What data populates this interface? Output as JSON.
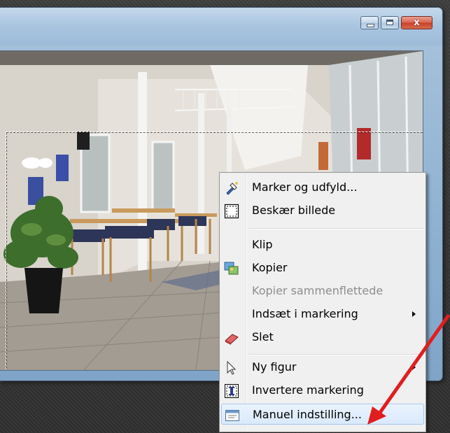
{
  "window": {
    "caption_buttons": [
      {
        "name": "minimize",
        "icon": "minimize-icon"
      },
      {
        "name": "maximize",
        "icon": "maximize-icon"
      },
      {
        "name": "close",
        "icon": "close-icon",
        "glyph": "x"
      }
    ]
  },
  "image": {
    "description_icon": "interior-photo"
  },
  "context_menu": {
    "items": [
      {
        "label": "Marker og udfyld...",
        "icon": "magic-wand-fill-icon",
        "enabled": true,
        "submenu": false
      },
      {
        "label": "Beskær billede",
        "icon": "crop-selection-icon",
        "enabled": true,
        "submenu": false
      },
      {
        "label": "Klip",
        "icon": "",
        "enabled": true,
        "submenu": false
      },
      {
        "label": "Kopier",
        "icon": "copy-images-icon",
        "enabled": true,
        "submenu": false
      },
      {
        "label": "Kopier sammenflettede",
        "icon": "",
        "enabled": false,
        "submenu": false
      },
      {
        "label": "Indsæt i markering",
        "icon": "",
        "enabled": true,
        "submenu": true
      },
      {
        "label": "Slet",
        "icon": "eraser-icon",
        "enabled": true,
        "submenu": false
      },
      {
        "label": "Ny figur",
        "icon": "cursor-arrow-icon",
        "enabled": true,
        "submenu": true
      },
      {
        "label": "Invertere markering",
        "icon": "invert-selection-icon",
        "enabled": true,
        "submenu": false
      },
      {
        "label": "Manuel indstilling...",
        "icon": "window-settings-icon",
        "enabled": true,
        "submenu": false,
        "highlighted": true
      }
    ]
  },
  "colors": {
    "annotation_arrow": "#e01e1e",
    "menu_background": "#f0f0f0",
    "highlight": "#d9eafb"
  }
}
